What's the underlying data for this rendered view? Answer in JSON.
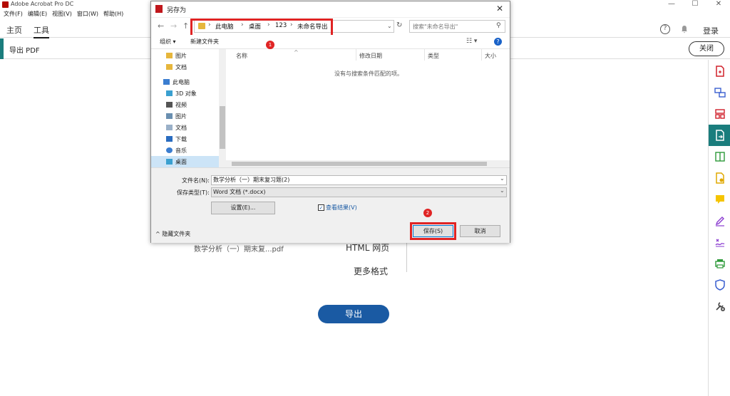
{
  "app": {
    "title": "Adobe Acrobat Pro DC",
    "menu": [
      "文件(F)",
      "编辑(E)",
      "视图(V)",
      "窗口(W)",
      "帮助(H)"
    ],
    "window_controls": {
      "minimize": "—",
      "maximize": "☐",
      "close": "✕"
    }
  },
  "nav": {
    "home": "主页",
    "tools": "工具",
    "help": "?",
    "login": "登录"
  },
  "toolbar": {
    "title": "导出 PDF",
    "close": "关闭"
  },
  "right_rail": {
    "icons": [
      "create-pdf-icon",
      "combine-files-icon",
      "organize-pages-icon",
      "export-pdf-icon",
      "edit-pdf-icon",
      "comment-icon",
      "annotate-icon",
      "fill-sign-icon",
      "request-signature-icon",
      "print-production-icon",
      "protect-icon",
      "more-tools-icon"
    ]
  },
  "background": {
    "file_name": "数学分析（一）期末复...pdf",
    "formats": [
      "HTML 网页",
      "更多格式"
    ],
    "export_button": "导出"
  },
  "dialog": {
    "title": "另存为",
    "close": "✕",
    "back": "←",
    "forward": "→",
    "up": "↑",
    "breadcrumb": [
      "此电脑",
      "桌面",
      "123",
      "未命名导出"
    ],
    "refresh": "↻",
    "search_placeholder": "搜索\"未命名导出\"",
    "organize": "组织 ▾",
    "new_folder": "新建文件夹",
    "badge1": "1",
    "nav_items": [
      {
        "label": "图片",
        "icon": "folder-icon"
      },
      {
        "label": "文档",
        "icon": "folder-icon"
      },
      {
        "label": "此电脑",
        "icon": "pc-icon"
      },
      {
        "label": "3D 对象",
        "icon": "3d-objects-icon"
      },
      {
        "label": "视频",
        "icon": "video-icon"
      },
      {
        "label": "图片",
        "icon": "pictures-icon"
      },
      {
        "label": "文档",
        "icon": "documents-icon"
      },
      {
        "label": "下载",
        "icon": "download-icon"
      },
      {
        "label": "音乐",
        "icon": "music-icon"
      },
      {
        "label": "桌面",
        "icon": "desktop-icon"
      }
    ],
    "columns": [
      "名称",
      "修改日期",
      "类型",
      "大小"
    ],
    "empty_message": "没有与搜索条件匹配的项。",
    "file_name_label": "文件名(N):",
    "file_name_value": "数学分析（一）期末复习题(2)",
    "file_type_label": "保存类型(T):",
    "file_type_value": "Word 文档 (*.docx)",
    "settings": "设置(E)...",
    "view_result": "查看结果(V)",
    "hide_folders": "隐藏文件夹",
    "save": "保存(S)",
    "cancel": "取消",
    "badge2": "2"
  },
  "colors": {
    "accent": "#1a7d7d",
    "export_button": "#1a5aa3",
    "highlight": "#e02424"
  }
}
